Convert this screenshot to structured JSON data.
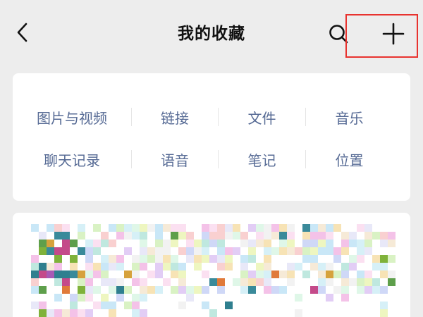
{
  "header": {
    "title": "我的收藏",
    "back_icon": "chevron-left-icon",
    "search_icon": "search-icon",
    "add_icon": "plus-icon",
    "highlight_color": "#e8332f"
  },
  "categories": [
    [
      "图片与视频",
      "链接",
      "文件",
      "音乐"
    ],
    [
      "聊天记录",
      "语音",
      "笔记",
      "位置"
    ]
  ],
  "colors": {
    "background": "#ededed",
    "card": "#ffffff",
    "link_text": "#576b95",
    "title_text": "#111111",
    "divider": "#e5e5e5"
  }
}
